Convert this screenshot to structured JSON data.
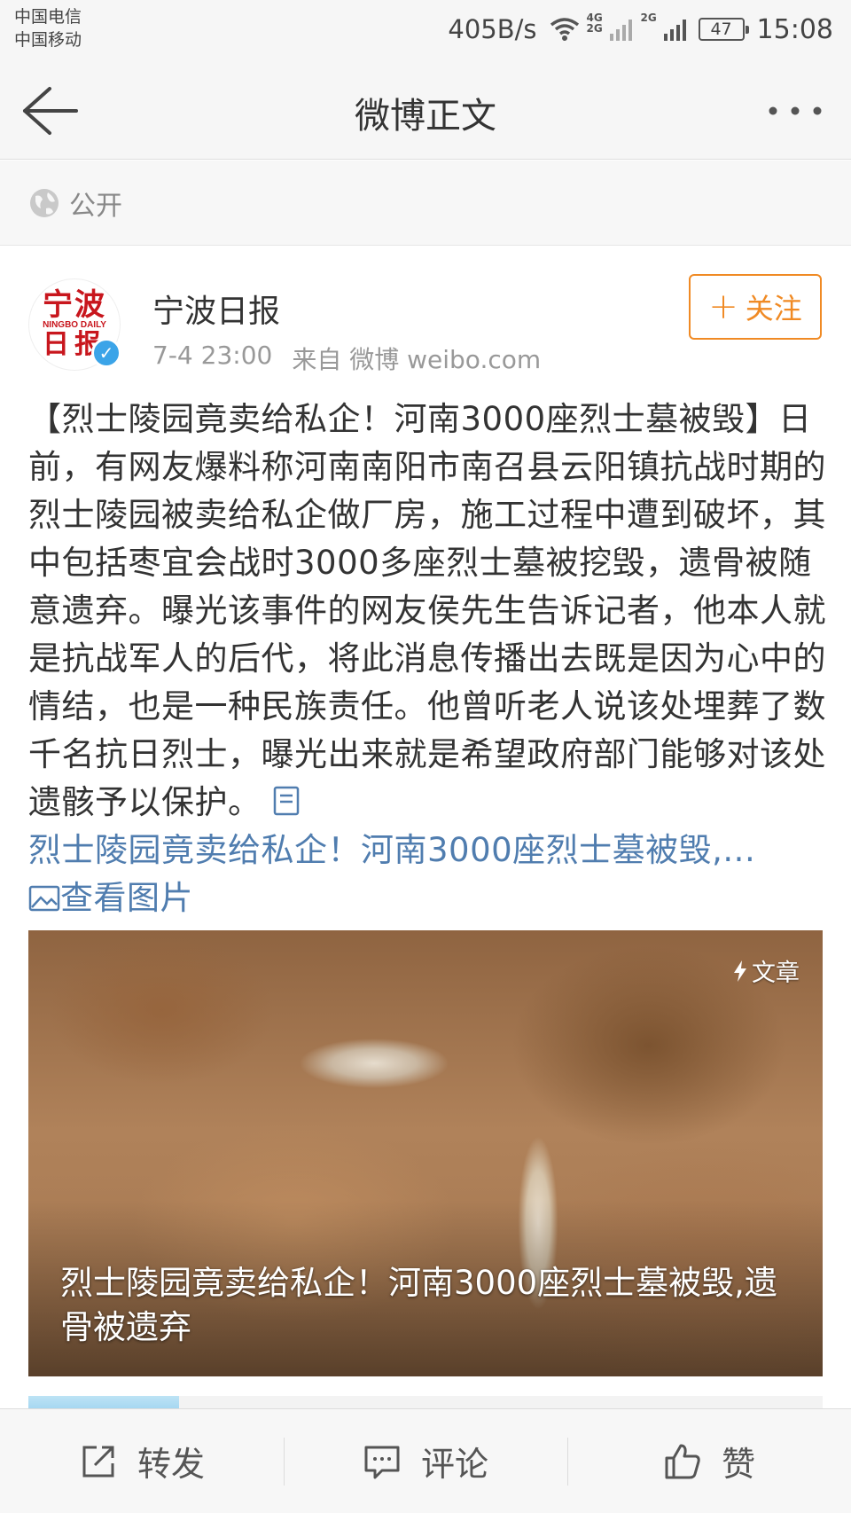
{
  "status_bar": {
    "carrier_1": "中国电信",
    "carrier_2": "中国移动",
    "net_speed": "405B/s",
    "sim1_label": "4G 2G",
    "sim2_label": "2G",
    "battery": "47",
    "time": "15:08"
  },
  "header": {
    "title": "微博正文"
  },
  "visibility": {
    "label": "公开"
  },
  "post": {
    "author": "宁波日报",
    "avatar_text_top": "宁波",
    "avatar_text_mid": "NINGBO DAILY",
    "avatar_text_bottom": "日报",
    "time": "7-4 23:00",
    "source": "来自 微博 weibo.com",
    "follow_label": "关注",
    "text": "【烈士陵园竟卖给私企！河南3000座烈士墓被毁】日前，有网友爆料称河南南阳市南召县云阳镇抗战时期的烈士陵园被卖给私企做厂房，施工过程中遭到破坏，其中包括枣宜会战时3000多座烈士墓被挖毁，遗骨被随意遗弃。曝光该事件的网友侯先生告诉记者，他本人就是抗战军人的后代，将此消息传播出去既是因为心中的情结，也是一种民族责任。他曾听老人说该处埋葬了数千名抗日烈士，曝光出来就是希望政府部门能够对该处遗骸予以保护。",
    "article_link": "烈士陵园竟卖给私企！河南3000座烈士墓被毁,...",
    "view_images": "查看图片",
    "card": {
      "badge": "文章",
      "caption": "烈士陵园竟卖给私企！河南3000座烈士墓被毁,遗骨被遗弃"
    }
  },
  "bottom_bar": {
    "repost": "转发",
    "comment": "评论",
    "like": "赞"
  },
  "colors": {
    "link": "#507daf",
    "follow": "#f08a24",
    "verify": "#3ba4e8"
  }
}
